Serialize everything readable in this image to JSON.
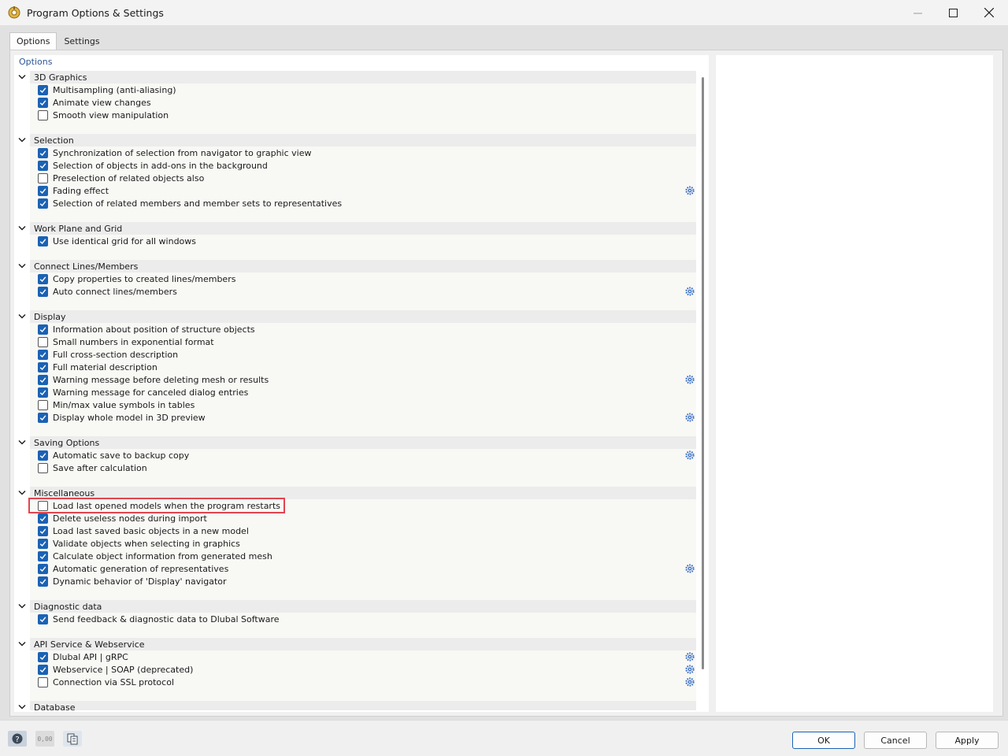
{
  "window": {
    "title": "Program Options & Settings"
  },
  "tabs": [
    {
      "label": "Options"
    },
    {
      "label": "Settings"
    }
  ],
  "options_header": "Options",
  "groups": [
    {
      "label": "3D Graphics",
      "items": [
        {
          "label": "Multisampling (anti-aliasing)",
          "checked": true,
          "gear": false
        },
        {
          "label": "Animate view changes",
          "checked": true,
          "gear": false
        },
        {
          "label": "Smooth view manipulation",
          "checked": false,
          "gear": false
        }
      ]
    },
    {
      "label": "Selection",
      "items": [
        {
          "label": "Synchronization of selection from navigator to graphic view",
          "checked": true,
          "gear": false
        },
        {
          "label": "Selection of objects in add-ons in the background",
          "checked": true,
          "gear": false
        },
        {
          "label": "Preselection of related objects also",
          "checked": false,
          "gear": false
        },
        {
          "label": "Fading effect",
          "checked": true,
          "gear": true
        },
        {
          "label": "Selection of related members and member sets to representatives",
          "checked": true,
          "gear": false
        }
      ]
    },
    {
      "label": "Work Plane and Grid",
      "items": [
        {
          "label": "Use identical grid for all windows",
          "checked": true,
          "gear": false
        }
      ]
    },
    {
      "label": "Connect Lines/Members",
      "items": [
        {
          "label": "Copy properties to created lines/members",
          "checked": true,
          "gear": false
        },
        {
          "label": "Auto connect lines/members",
          "checked": true,
          "gear": true
        }
      ]
    },
    {
      "label": "Display",
      "items": [
        {
          "label": "Information about position of structure objects",
          "checked": true,
          "gear": false
        },
        {
          "label": "Small numbers in exponential format",
          "checked": false,
          "gear": false
        },
        {
          "label": "Full cross-section description",
          "checked": true,
          "gear": false
        },
        {
          "label": "Full material description",
          "checked": true,
          "gear": false
        },
        {
          "label": "Warning message before deleting mesh or results",
          "checked": true,
          "gear": true
        },
        {
          "label": "Warning message for canceled dialog entries",
          "checked": true,
          "gear": false
        },
        {
          "label": "Min/max value symbols in tables",
          "checked": false,
          "gear": false
        },
        {
          "label": "Display whole model in 3D preview",
          "checked": true,
          "gear": true
        }
      ]
    },
    {
      "label": "Saving Options",
      "items": [
        {
          "label": "Automatic save to backup copy",
          "checked": true,
          "gear": true
        },
        {
          "label": "Save after calculation",
          "checked": false,
          "gear": false
        }
      ]
    },
    {
      "label": "Miscellaneous",
      "items": [
        {
          "label": "Load last opened models when the program restarts",
          "checked": false,
          "gear": false,
          "highlight": true
        },
        {
          "label": "Delete useless nodes during import",
          "checked": true,
          "gear": false
        },
        {
          "label": "Load last saved basic objects in a new model",
          "checked": true,
          "gear": false
        },
        {
          "label": "Validate objects when selecting in graphics",
          "checked": true,
          "gear": false
        },
        {
          "label": "Calculate object information from generated mesh",
          "checked": true,
          "gear": false
        },
        {
          "label": "Automatic generation of representatives",
          "checked": true,
          "gear": true
        },
        {
          "label": "Dynamic behavior of 'Display' navigator",
          "checked": true,
          "gear": false
        }
      ]
    },
    {
      "label": "Diagnostic data",
      "items": [
        {
          "label": "Send feedback & diagnostic data to Dlubal Software",
          "checked": true,
          "gear": false
        }
      ]
    },
    {
      "label": "API Service & Webservice",
      "items": [
        {
          "label": "Dlubal API | gRPC",
          "checked": true,
          "gear": true
        },
        {
          "label": "Webservice | SOAP (deprecated)",
          "checked": true,
          "gear": true
        },
        {
          "label": "Connection via SSL protocol",
          "checked": false,
          "gear": true
        }
      ]
    },
    {
      "label": "Database",
      "items": []
    }
  ],
  "footer": {
    "icons": [
      "help-icon",
      "units-icon",
      "copy-settings-icon"
    ],
    "units_icon_text": "0,00",
    "ok_label": "OK",
    "cancel_label": "Cancel",
    "apply_label": "Apply"
  },
  "colors": {
    "checkbox_accent": "#1b62b4",
    "highlight": "#e0454f",
    "header_text": "#2b5797",
    "gear": "#3a6fc4"
  }
}
